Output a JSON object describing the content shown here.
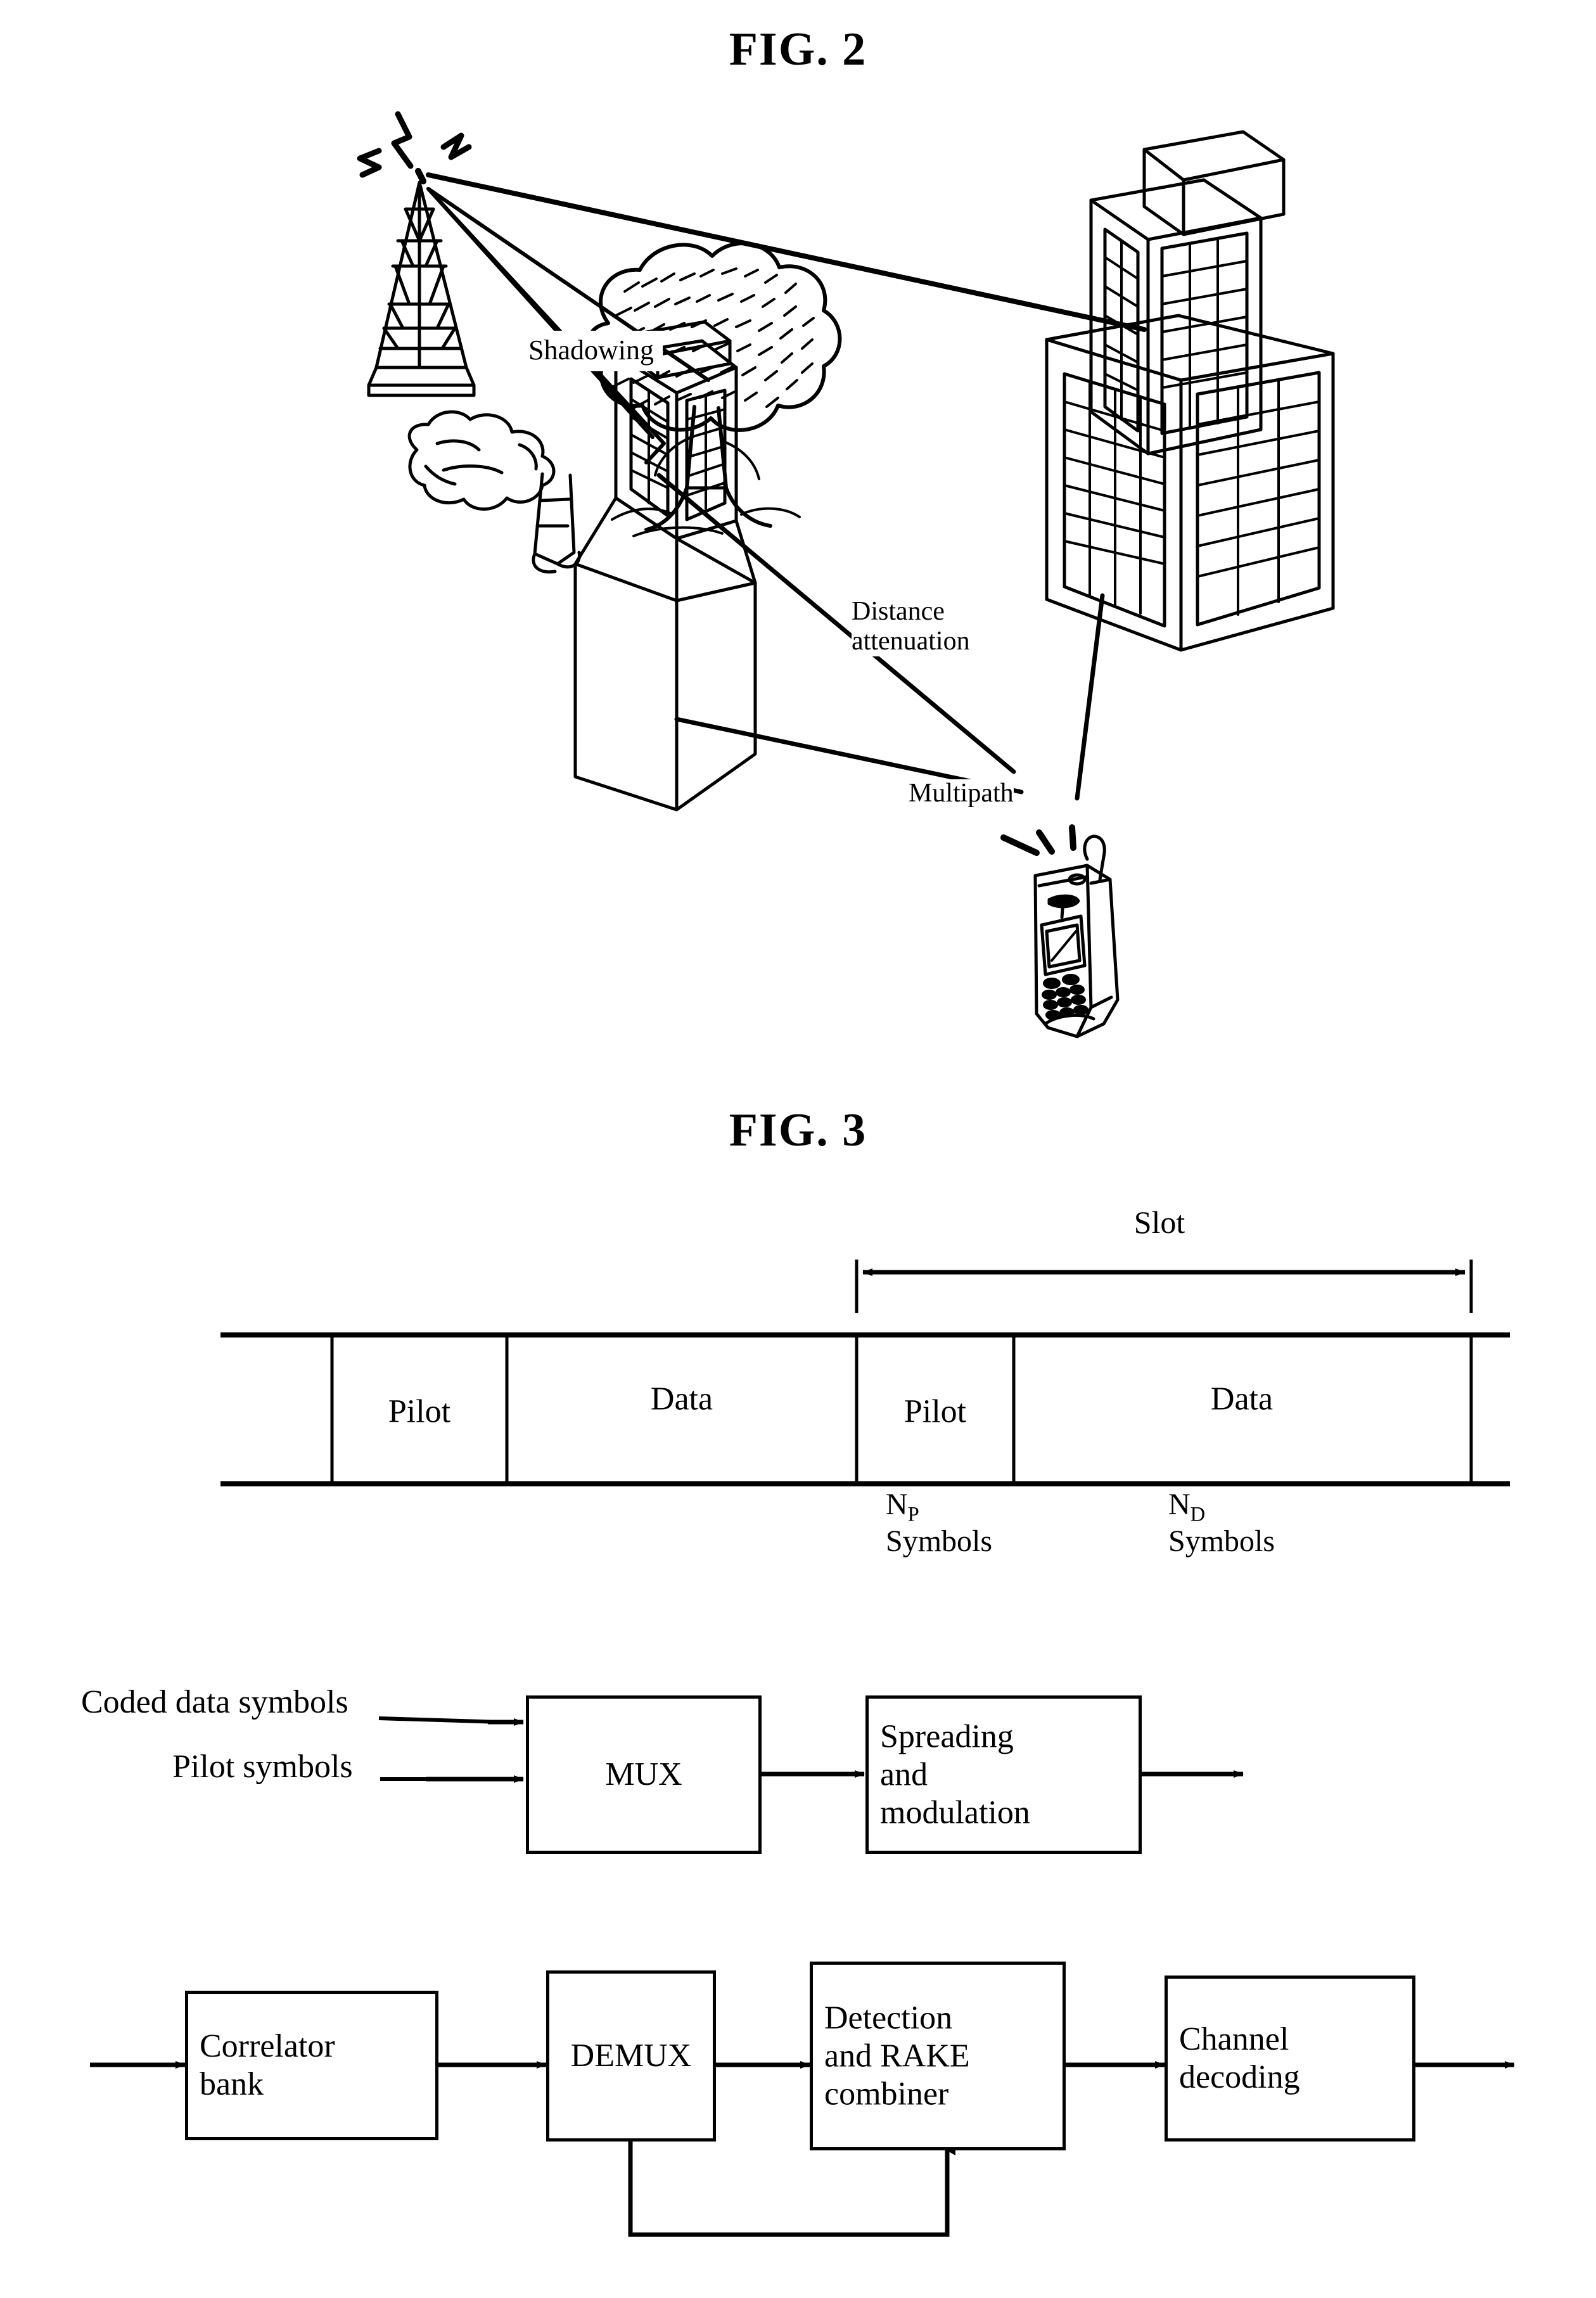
{
  "figures": [
    {
      "id": "fig2",
      "title": "FIG. 2"
    },
    {
      "id": "fig3",
      "title": "FIG. 3"
    }
  ],
  "fig2": {
    "title": "FIG. 2",
    "caption_labels": {
      "shadowing": "Shadowing",
      "distance_attenuation_line1": "Distance",
      "distance_attenuation_line2": "attenuation",
      "multipath": "Multipath"
    },
    "scene_elements": [
      "antenna-tower",
      "radio-waves",
      "tree",
      "bush",
      "tall-building",
      "short-building",
      "mobile-phone",
      "propagation-paths"
    ]
  },
  "fig3": {
    "title": "FIG. 3",
    "slot_diagram": {
      "span_label": "Slot",
      "cells": [
        {
          "label": "Pilot"
        },
        {
          "label": "Data"
        },
        {
          "label": "Pilot"
        },
        {
          "label": "Data"
        }
      ],
      "annotations": [
        {
          "symbol": "N",
          "subscript": "P",
          "text": "Symbols"
        },
        {
          "symbol": "N",
          "subscript": "D",
          "text": "Symbols"
        }
      ]
    },
    "transmitter_chain": {
      "inputs": [
        {
          "label": "Coded data symbols"
        },
        {
          "label": "Pilot symbols"
        }
      ],
      "blocks": [
        {
          "label": "MUX",
          "align": "center"
        },
        {
          "label": "Spreading\nand\nmodulation",
          "align": "left"
        }
      ]
    },
    "receiver_chain": {
      "blocks": [
        {
          "label": "Correlator\nbank",
          "align": "left"
        },
        {
          "label": "DEMUX",
          "align": "center"
        },
        {
          "label": "Detection\nand RAKE\ncombiner",
          "align": "left"
        },
        {
          "label": "Channel\ndecoding",
          "align": "left"
        }
      ],
      "feedback": "demux-to-detection-feedback"
    }
  },
  "colors": {
    "ink": "#000000",
    "paper": "#ffffff"
  }
}
